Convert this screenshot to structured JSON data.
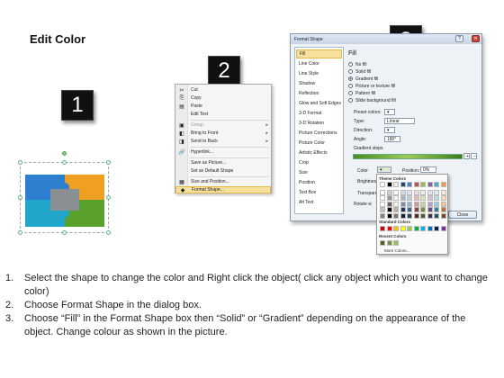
{
  "title": "Edit Color",
  "steps": [
    "1",
    "2",
    "3"
  ],
  "menu": {
    "items": [
      {
        "icon": "cut-icon",
        "glyph": "✂",
        "label": "Cut",
        "enabled": true
      },
      {
        "icon": "copy-icon",
        "glyph": "⎘",
        "label": "Copy",
        "enabled": true
      },
      {
        "icon": "paste-icon",
        "glyph": "▤",
        "label": "Paste",
        "enabled": true
      },
      {
        "icon": "",
        "glyph": "",
        "label": "Edit Text",
        "enabled": true
      },
      {
        "icon": "group-icon",
        "glyph": "▣",
        "label": "Group",
        "enabled": false,
        "submenu": true
      },
      {
        "icon": "bring-front-icon",
        "glyph": "◧",
        "label": "Bring to Front",
        "enabled": true,
        "submenu": true
      },
      {
        "icon": "send-back-icon",
        "glyph": "◨",
        "label": "Send to Back",
        "enabled": true,
        "submenu": true
      },
      {
        "icon": "hyperlink-icon",
        "glyph": "🔗",
        "label": "Hyperlink...",
        "enabled": true
      },
      {
        "icon": "",
        "glyph": "",
        "label": "Save as Picture...",
        "enabled": true
      },
      {
        "icon": "",
        "glyph": "",
        "label": "Set as Default Shape",
        "enabled": true
      },
      {
        "icon": "size-position-icon",
        "glyph": "▦",
        "label": "Size and Position...",
        "enabled": true
      },
      {
        "icon": "format-shape-icon",
        "glyph": "◆",
        "label": "Format Shape...",
        "enabled": true,
        "highlighted": true
      }
    ]
  },
  "dialog": {
    "title": "Format Shape",
    "nav": [
      "Fill",
      "Line Color",
      "Line Style",
      "Shadow",
      "Reflection",
      "Glow and Soft Edges",
      "3-D Format",
      "3-D Rotation",
      "Picture Corrections",
      "Picture Color",
      "Artistic Effects",
      "Crop",
      "Size",
      "Position",
      "Text Box",
      "Alt Text"
    ],
    "section_title": "Fill",
    "fill_options": [
      {
        "label": "No fill",
        "checked": false
      },
      {
        "label": "Solid fill",
        "checked": false
      },
      {
        "label": "Gradient fill",
        "checked": true
      },
      {
        "label": "Picture or texture fill",
        "checked": false
      },
      {
        "label": "Pattern fill",
        "checked": false
      },
      {
        "label": "Slide background fill",
        "checked": false
      }
    ],
    "preset_label": "Preset colors:",
    "type_label": "Type:",
    "type_value": "Linear",
    "direction_label": "Direction:",
    "angle_label": "Angle:",
    "angle_value": "180°",
    "stops_label": "Gradient stops",
    "color_label": "Color",
    "position_label": "Position:",
    "position_value": "0%",
    "brightness_label": "Brightness",
    "transparency_label": "Transpare",
    "rotate_label": "Rotate w",
    "close_label": "Close"
  },
  "picker": {
    "theme_label": "Theme Colors",
    "standard_label": "Standard Colors",
    "recent_label": "Recent Colors",
    "more_label": "More Colors...",
    "theme_top": [
      "#ffffff",
      "#000000",
      "#eeece1",
      "#1f497d",
      "#4f81bd",
      "#c0504d",
      "#9bbb59",
      "#8064a2",
      "#4bacc6",
      "#f79646"
    ],
    "standard": [
      "#c00000",
      "#ff0000",
      "#ffc000",
      "#ffff00",
      "#92d050",
      "#00b050",
      "#00b0f0",
      "#0070c0",
      "#002060",
      "#7030a0"
    ],
    "recent": [
      "#4f6228",
      "#76923c",
      "#9bbb59"
    ]
  },
  "puzzle_colors": {
    "blue": "#2e7fd0",
    "orange": "#f0a020",
    "teal": "#1fa6c8",
    "green": "#5aa02c",
    "gray": "#8a8f94"
  },
  "instructions": [
    {
      "num": "1.",
      "text": "Select the shape to change the color and Right click the object( click any object which you want to change color)"
    },
    {
      "num": "2.",
      "text": "Choose Format Shape in the dialog box."
    },
    {
      "num": "3.",
      "text": "Choose “Fill” in the Format Shape box then “Solid” or “Gradient” depending on the appearance of the object. Change colour as shown in the picture."
    }
  ]
}
